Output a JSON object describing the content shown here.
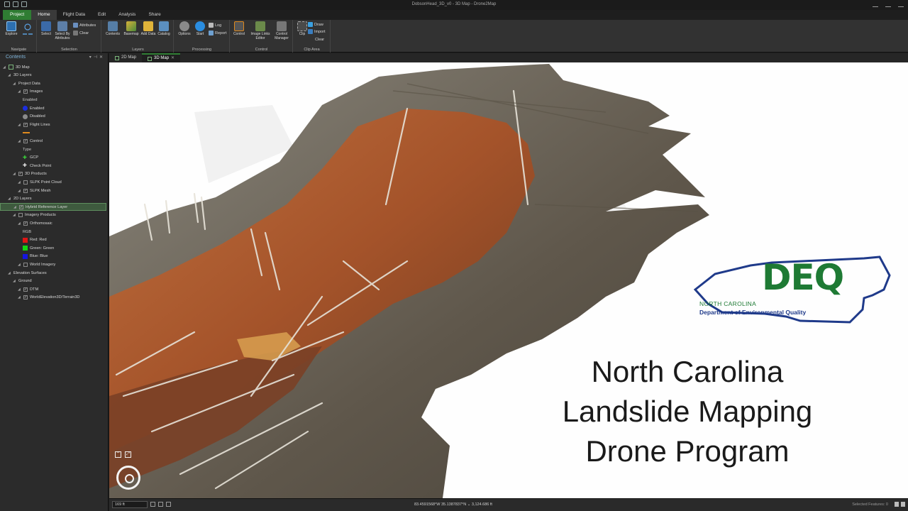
{
  "window": {
    "title": "DobsonHead_3D_v0 - 3D Map - Drone2Map"
  },
  "ribbon_tabs": [
    "Project",
    "Home",
    "Flight Data",
    "Edit",
    "Analysis",
    "Share"
  ],
  "ribbon": {
    "navigate": {
      "label": "Navigate",
      "explore": "Explore"
    },
    "selection": {
      "label": "Selection",
      "select": "Select",
      "select_by": "Select By Attributes",
      "attributes": "Attributes",
      "clear": "Clear"
    },
    "layers": {
      "label": "Layers",
      "contents": "Contents",
      "basemap": "Basemap",
      "add_data": "Add Data",
      "catalog": "Catalog"
    },
    "processing": {
      "label": "Processing",
      "options": "Options",
      "start": "Start",
      "log": "Log",
      "report": "Report"
    },
    "control": {
      "label": "Control",
      "control": "Control",
      "image_links": "Image Links Editor",
      "control_manager": "Control Manager"
    },
    "clip": {
      "label": "Clip Area",
      "clip": "Clip",
      "draw": "Draw",
      "import": "Import",
      "clear": "Clear"
    }
  },
  "contents": {
    "title": "Contents",
    "items": [
      {
        "label": "3D Map",
        "indent": 0,
        "kind": "map"
      },
      {
        "label": "3D Layers",
        "indent": 1,
        "kind": "group"
      },
      {
        "label": "Project Data",
        "indent": 2,
        "kind": "group"
      },
      {
        "label": "Images",
        "indent": 3,
        "kind": "check"
      },
      {
        "label": "Enabled",
        "indent": 4,
        "kind": "heading"
      },
      {
        "label": "Enabled",
        "indent": 4,
        "kind": "symbol",
        "symbol": "circle",
        "color": "#1c2ee0"
      },
      {
        "label": "Disabled",
        "indent": 4,
        "kind": "symbol",
        "symbol": "circle",
        "color": "#8a8a8a"
      },
      {
        "label": "Flight Lines",
        "indent": 3,
        "kind": "check"
      },
      {
        "label": "",
        "indent": 4,
        "kind": "symbol",
        "symbol": "line",
        "color": "#e08a1e"
      },
      {
        "label": "Control",
        "indent": 3,
        "kind": "check"
      },
      {
        "label": "Type",
        "indent": 4,
        "kind": "heading"
      },
      {
        "label": "GCP",
        "indent": 4,
        "kind": "symbol",
        "symbol": "plus",
        "color": "#3ad13a"
      },
      {
        "label": "Check Point",
        "indent": 4,
        "kind": "symbol",
        "symbol": "plus",
        "color": "#e8e8e8"
      },
      {
        "label": "3D Products",
        "indent": 2,
        "kind": "check"
      },
      {
        "label": "SLPK Point Cloud",
        "indent": 3,
        "kind": "uncheck"
      },
      {
        "label": "SLPK Mesh",
        "indent": 3,
        "kind": "check"
      },
      {
        "label": "2D Layers",
        "indent": 1,
        "kind": "group"
      },
      {
        "label": "Hybrid Reference Layer",
        "indent": 2,
        "kind": "check",
        "selected": true
      },
      {
        "label": "Imagery Products",
        "indent": 2,
        "kind": "uncheck"
      },
      {
        "label": "Orthomosaic",
        "indent": 3,
        "kind": "check"
      },
      {
        "label": "RGB",
        "indent": 4,
        "kind": "heading"
      },
      {
        "label": "Red:   Red",
        "indent": 4,
        "kind": "symbol",
        "symbol": "square",
        "color": "#e01515"
      },
      {
        "label": "Green: Green",
        "indent": 4,
        "kind": "symbol",
        "symbol": "square",
        "color": "#13d413"
      },
      {
        "label": "Blue:  Blue",
        "indent": 4,
        "kind": "symbol",
        "symbol": "square",
        "color": "#1515e0"
      },
      {
        "label": "World Imagery",
        "indent": 3,
        "kind": "uncheck"
      },
      {
        "label": "Elevation Surfaces",
        "indent": 1,
        "kind": "group"
      },
      {
        "label": "Ground",
        "indent": 2,
        "kind": "group"
      },
      {
        "label": "DTM",
        "indent": 3,
        "kind": "check"
      },
      {
        "label": "WorldElevation3D/Terrain3D",
        "indent": 3,
        "kind": "check"
      }
    ]
  },
  "view_tabs": [
    {
      "label": "2D Map",
      "active": false
    },
    {
      "label": "3D Map",
      "active": true
    }
  ],
  "overlay": {
    "logo_text": "DEQ",
    "logo_state": "NORTH CAROLINA",
    "logo_dept": "Department of Environmental Quality",
    "headline": [
      "North Carolina",
      "Landslide Mapping",
      "Drone Program"
    ]
  },
  "status": {
    "scale": "169 ft",
    "coordinates": "83.4591568°W 35.1387837°N  ⌄  3,124.686 ft",
    "selected_features": "Selected Features: 0"
  },
  "colors": {
    "accent_green": "#2f7d33",
    "deq_green": "#1e7a34",
    "deq_blue": "#1f3a8a"
  }
}
